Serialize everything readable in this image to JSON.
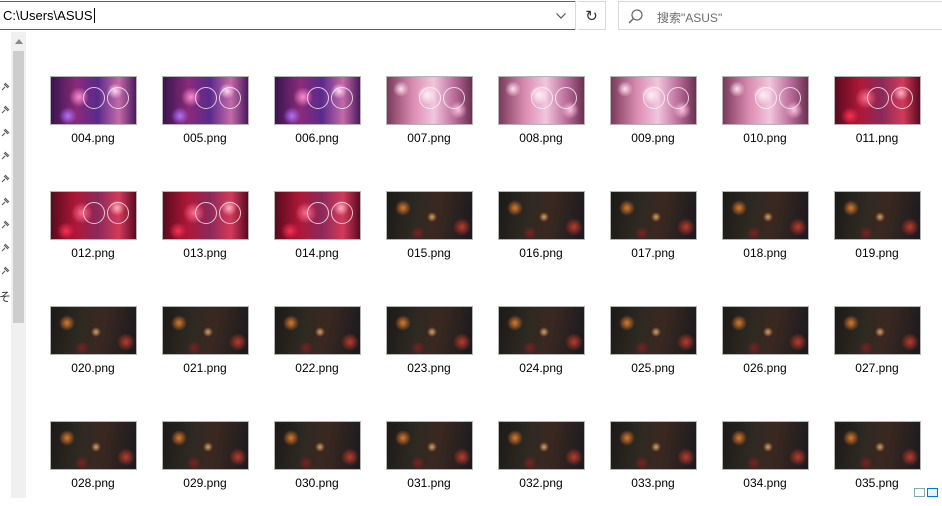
{
  "address_bar": {
    "path": "C:\\Users\\ASUS"
  },
  "search": {
    "placeholder": "搜索\"ASUS\""
  },
  "icons": {
    "dropdown": "chevron-down-icon",
    "refresh": "refresh-icon",
    "search": "search-icon",
    "pin": "pin-icon"
  },
  "colors": {
    "accent": "#0078d7",
    "scroll_thumb": "#cdcdcd"
  },
  "files": [
    {
      "name": "004.png",
      "theme": "magenta"
    },
    {
      "name": "005.png",
      "theme": "magenta"
    },
    {
      "name": "006.png",
      "theme": "magenta"
    },
    {
      "name": "007.png",
      "theme": "pink"
    },
    {
      "name": "008.png",
      "theme": "pink"
    },
    {
      "name": "009.png",
      "theme": "pink"
    },
    {
      "name": "010.png",
      "theme": "pink"
    },
    {
      "name": "011.png",
      "theme": "red"
    },
    {
      "name": "012.png",
      "theme": "red"
    },
    {
      "name": "013.png",
      "theme": "red"
    },
    {
      "name": "014.png",
      "theme": "red"
    },
    {
      "name": "015.png",
      "theme": "dark"
    },
    {
      "name": "016.png",
      "theme": "dark"
    },
    {
      "name": "017.png",
      "theme": "dark"
    },
    {
      "name": "018.png",
      "theme": "dark"
    },
    {
      "name": "019.png",
      "theme": "dark"
    },
    {
      "name": "020.png",
      "theme": "dark"
    },
    {
      "name": "021.png",
      "theme": "dark"
    },
    {
      "name": "022.png",
      "theme": "dark"
    },
    {
      "name": "023.png",
      "theme": "dark"
    },
    {
      "name": "024.png",
      "theme": "dark"
    },
    {
      "name": "025.png",
      "theme": "dark"
    },
    {
      "name": "026.png",
      "theme": "dark"
    },
    {
      "name": "027.png",
      "theme": "dark"
    },
    {
      "name": "028.png",
      "theme": "dark"
    },
    {
      "name": "029.png",
      "theme": "dark"
    },
    {
      "name": "030.png",
      "theme": "dark"
    },
    {
      "name": "031.png",
      "theme": "dark"
    },
    {
      "name": "032.png",
      "theme": "dark"
    },
    {
      "name": "033.png",
      "theme": "dark"
    },
    {
      "name": "034.png",
      "theme": "dark"
    },
    {
      "name": "035.png",
      "theme": "dark"
    }
  ]
}
